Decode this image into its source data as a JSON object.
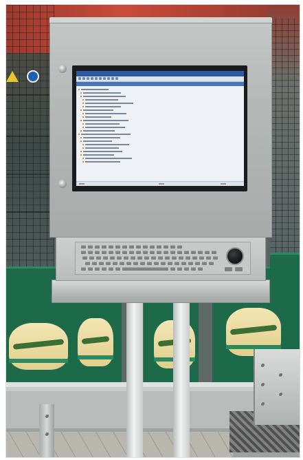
{
  "scene": {
    "subject": "industrial-touch-panel-pc",
    "monitor_app": {
      "title_text": "",
      "tree_rows": 22
    },
    "colors": {
      "enclosure": "#b3b7b6",
      "crate": "#1d6a4a",
      "label": "#f2e6b4",
      "background_wall": "#c94a3a"
    }
  }
}
